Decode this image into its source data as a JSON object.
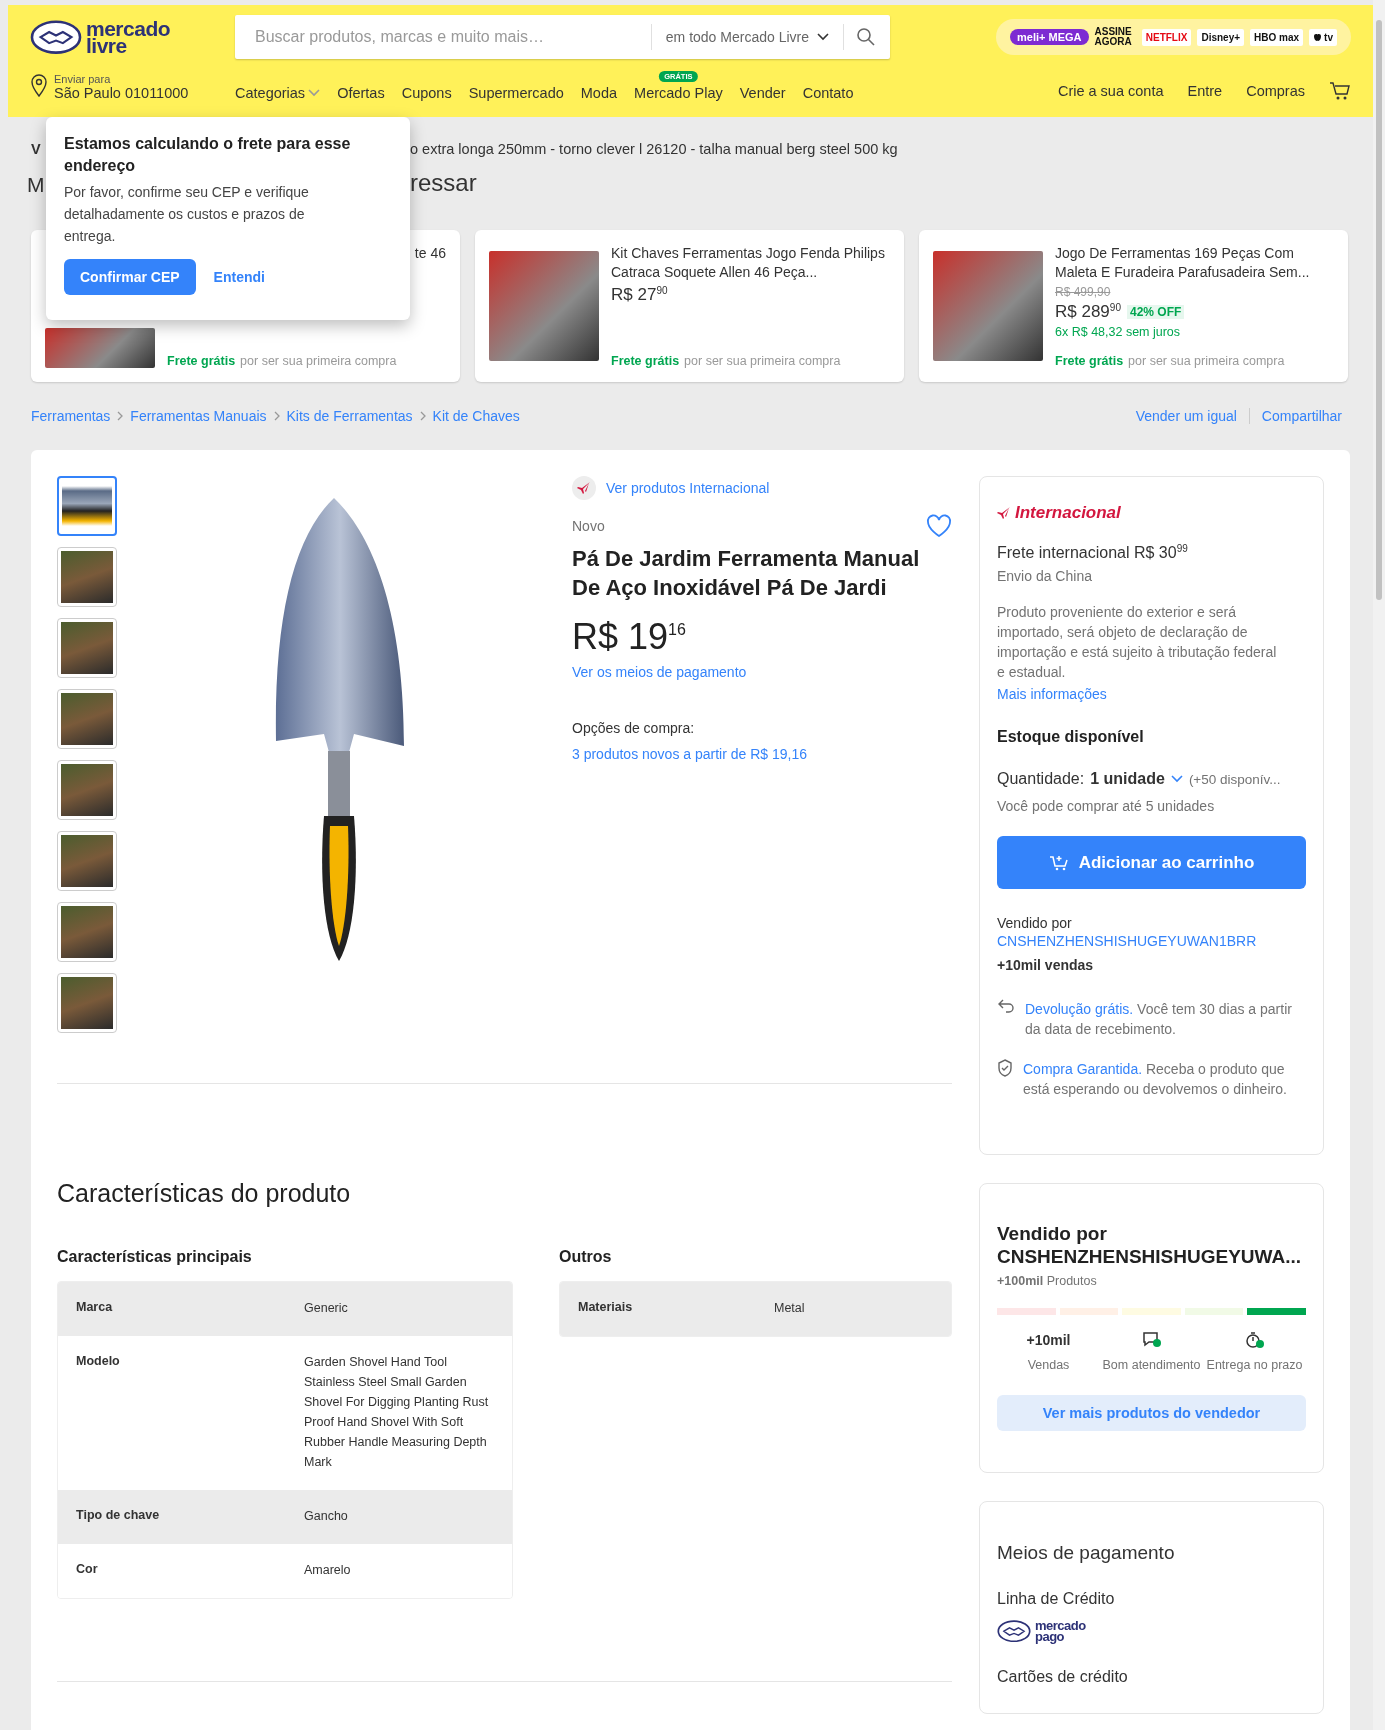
{
  "header": {
    "logo": {
      "line1": "mercado",
      "line2": "livre"
    },
    "search": {
      "placeholder": "Buscar produtos, marcas e muito mais…",
      "scope": "em todo Mercado Livre"
    },
    "promo": {
      "meli": "meli+",
      "mega": "MEGA",
      "assine": "ASSINE AGORA",
      "brands": [
        "NETFLIX",
        "Disney+",
        "HBO max",
        "tv"
      ]
    },
    "location": {
      "label": "Enviar para",
      "value": "São Paulo 01011000"
    },
    "nav": [
      {
        "label": "Categorias",
        "dropdown": true
      },
      {
        "label": "Ofertas"
      },
      {
        "label": "Cupons"
      },
      {
        "label": "Supermercado"
      },
      {
        "label": "Moda"
      },
      {
        "label": "Mercado Play",
        "badge": "GRÁTIS"
      },
      {
        "label": "Vender"
      },
      {
        "label": "Contato"
      }
    ],
    "account": [
      "Crie a sua conta",
      "Entre",
      "Compras"
    ]
  },
  "popup": {
    "title": "Estamos calculando o frete para esse endereço",
    "body": "Por favor, confirme seu CEP e verifique detalhadamente os custos e prazos de entrega.",
    "confirm": "Confirmar CEP",
    "dismiss": "Entendi"
  },
  "history": {
    "start": "V",
    "rest": "o extra longa 250mm - torno clever l 26120 - talha manual berg steel 500 kg"
  },
  "related_heading": {
    "start": "M",
    "rest": "ressar"
  },
  "related": [
    {
      "title": "te 46",
      "shipping": "Frete grátis",
      "shipping_note": "por ser sua primeira compra"
    },
    {
      "title": "Kit Chaves Ferramentas Jogo Fenda Philips Catraca Soquete Allen 46 Peça...",
      "price": "R$ 27",
      "cents": "90",
      "shipping": "Frete grátis",
      "shipping_note": "por ser sua primeira compra"
    },
    {
      "title": "Jogo De Ferramentas 169 Peças Com Maleta E Furadeira Parafusadeira Sem...",
      "old_price": "R$ 499,90",
      "price": "R$ 289",
      "cents": "90",
      "discount": "42% OFF",
      "installments": "6x R$ 48,32 sem juros",
      "shipping": "Frete grátis",
      "shipping_note": "por ser sua primeira compra"
    }
  ],
  "breadcrumb": [
    "Ferramentas",
    "Ferramentas Manuais",
    "Kits de Ferramentas",
    "Kit de Chaves"
  ],
  "page_actions": [
    "Vender um igual",
    "Compartilhar"
  ],
  "thumbnails": [
    {
      "selected": true
    },
    {
      "selected": false
    },
    {
      "selected": false
    },
    {
      "selected": false
    },
    {
      "selected": false
    },
    {
      "selected": false
    },
    {
      "selected": false
    },
    {
      "selected": false
    }
  ],
  "product": {
    "international_link": "Ver produtos Internacional",
    "condition": "Novo",
    "title": "Pá De Jardim Ferramenta Manual De Aço Inoxidável Pá De Jardi",
    "price": "R$ 19",
    "cents": "16",
    "payment_link": "Ver os meios de pagamento",
    "options_label": "Opções de compra:",
    "options_link": "3 produtos novos a partir de R$ 19,16"
  },
  "buy_box": {
    "badge": "Internacional",
    "shipping": "Frete internacional R$ 30",
    "shipping_cents": "99",
    "origin": "Envio da China",
    "notice": "Produto proveniente do exterior e será importado, será objeto de declaração de importação e está sujeito à tributação federal e estadual.",
    "more_link": "Mais informações",
    "stock_title": "Estoque disponível",
    "quantity_label": "Quantidade:",
    "quantity_value": "1 unidade",
    "available": "(+50 disponív...",
    "limit": "Você pode comprar até 5 unidades",
    "add_button": "Adicionar ao carrinho",
    "sold_by": "Vendido por",
    "seller": "CNSHENZHENSHISHUGEYUWAN1BRR",
    "sales": "+10mil vendas",
    "benefits": [
      {
        "kind": "return",
        "link": "Devolução grátis.",
        "text": "Você tem 30 dias a partir da data de recebimento."
      },
      {
        "kind": "shield",
        "link": "Compra Garantida.",
        "text": "Receba o produto que está esperando ou devolvemos o dinheiro."
      }
    ]
  },
  "specs": {
    "title": "Características do produto",
    "groups": [
      {
        "title": "Características principais",
        "rows": [
          {
            "label": "Marca",
            "value": "Generic"
          },
          {
            "label": "Modelo",
            "value": "Garden Shovel Hand Tool Stainless Steel Small Garden Shovel For Digging Planting Rust Proof Hand Shovel With Soft Rubber Handle Measuring Depth Mark"
          },
          {
            "label": "Tipo de chave",
            "value": "Gancho"
          },
          {
            "label": "Cor",
            "value": "Amarelo"
          }
        ]
      },
      {
        "title": "Outros",
        "rows": [
          {
            "label": "Materiais",
            "value": "Metal"
          }
        ]
      }
    ]
  },
  "seller_box": {
    "title": "Vendido por",
    "name": "CNSHENZHENSHISHUGEYUWA...",
    "products": "**+100mil** Produtos",
    "thermometer": [
      {
        "color": "#fde6e7"
      },
      {
        "color": "#fff0e6"
      },
      {
        "color": "#fefbe2"
      },
      {
        "color": "#f1fae6"
      },
      {
        "color": "#00a650"
      }
    ],
    "stats": [
      {
        "kind": "text",
        "value": "+10mil",
        "label": "Vendas"
      },
      {
        "kind": "chat",
        "label": "Bom atendimento"
      },
      {
        "kind": "timer",
        "label": "Entrega no prazo"
      }
    ],
    "button": "Ver mais produtos do vendedor"
  },
  "payment": {
    "title": "Meios de pagamento",
    "credit_line": "Linha de Crédito",
    "logo": {
      "line1": "mercado",
      "line2": "pago"
    },
    "cards": "Cartões de crédito"
  }
}
